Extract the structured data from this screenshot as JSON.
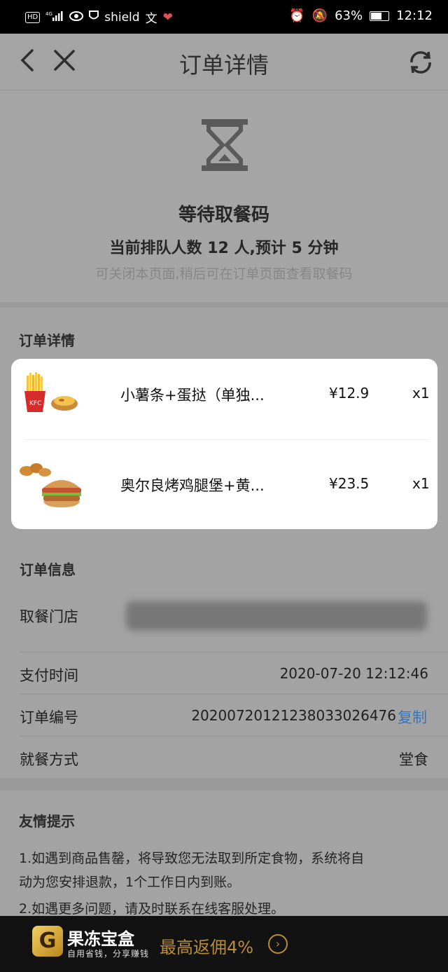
{
  "status_bar": {
    "left_icons": [
      "HD",
      "4G",
      "signal",
      "eye",
      "shield",
      "文",
      "文",
      "heart"
    ],
    "battery": "63%",
    "time": "12:12"
  },
  "header": {
    "title": "订单详情",
    "back_icon": "chevron-left-icon",
    "close_icon": "close-icon",
    "refresh_icon": "refresh-icon"
  },
  "wait": {
    "icon": "hourglass-icon",
    "title": "等待取餐码",
    "queue_text": "当前排队人数 12 人,预计 5 分钟",
    "hint": "可关闭本页面,稍后可在订单页面查看取餐码"
  },
  "order_details": {
    "section_label": "订单详情",
    "items": [
      {
        "name": "小薯条+蛋挞（单独...",
        "price": "¥12.9",
        "qty": "x1",
        "image": "fries-eggtart-image"
      },
      {
        "name": "奥尔良烤鸡腿堡+黄...",
        "price": "¥23.5",
        "qty": "x1",
        "image": "burger-nuggets-image"
      }
    ]
  },
  "order_info": {
    "section_label": "订单信息",
    "store_label": "取餐门店",
    "pay_time_label": "支付时间",
    "pay_time": "2020-07-20 12:12:46",
    "order_no_label": "订单编号",
    "order_no": "20200720121238033026476",
    "copy_label": "复制",
    "dining_label": "就餐方式",
    "dining_value": "堂食"
  },
  "tips": {
    "section_label": "友情提示",
    "line1": "1.如遇到商品售罄，将导致您无法取到所定食物，系统将自",
    "line1b": "动为您安排退款，1个工作日内到账。",
    "line2": "2.如遇更多问题，请及时联系在线客服处理。"
  },
  "bottom_banner": {
    "logo_letter": "G",
    "name": "果冻宝盒",
    "sub": "自用省钱，分享赚钱",
    "promo": "最高返佣4%",
    "arrow": "›"
  },
  "colors": {
    "accent": "#3a74b8",
    "promo_gold": "#b88c34"
  }
}
